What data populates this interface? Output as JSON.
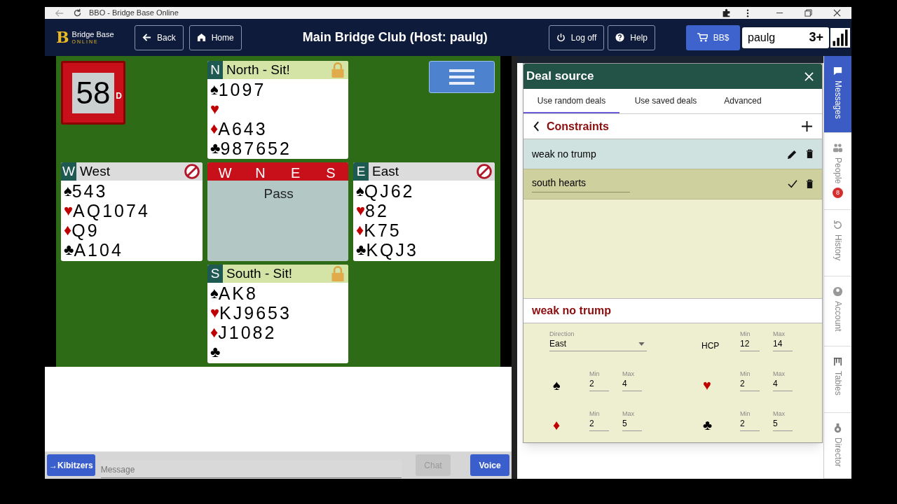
{
  "browser": {
    "title": "BBO - Bridge Base Online"
  },
  "nav": {
    "logo_mark": "B",
    "logo_text": "Bridge Base",
    "logo_subtext": "ONLINE",
    "left_buttons": [
      {
        "label": "Back"
      },
      {
        "label": "Home"
      }
    ],
    "title": "Main Bridge Club (Host: paulg)",
    "right_buttons": [
      {
        "label": "Log off"
      },
      {
        "label": "Help"
      }
    ],
    "bucks_button": "BB$",
    "username": "paulg",
    "rank": "3+"
  },
  "table": {
    "board": "58",
    "dealer": "D",
    "hands": [
      {
        "letter": "N",
        "name": "North - Sit!",
        "kind": "open",
        "suits": [
          {
            "kind": "spade",
            "symbol": "♠",
            "cards": "1097"
          },
          {
            "kind": "heart",
            "symbol": "♥"
          },
          {
            "kind": "diamond",
            "symbol": "♦",
            "cards": "A643"
          },
          {
            "kind": "club",
            "symbol": "♣",
            "cards": "987652"
          }
        ]
      },
      {
        "letter": "W",
        "name": "West",
        "kind": "occupied",
        "suits": [
          {
            "kind": "spade",
            "symbol": "♠",
            "cards": "543"
          },
          {
            "kind": "heart",
            "symbol": "♥",
            "cards": "AQ1074"
          },
          {
            "kind": "diamond",
            "symbol": "♦",
            "cards": "Q9"
          },
          {
            "kind": "club",
            "symbol": "♣",
            "cards": "A104"
          }
        ]
      },
      {
        "letter": "E",
        "name": "East",
        "kind": "occupied",
        "suits": [
          {
            "kind": "spade",
            "symbol": "♠",
            "cards": "QJ62"
          },
          {
            "kind": "heart",
            "symbol": "♥",
            "cards": "82"
          },
          {
            "kind": "diamond",
            "symbol": "♦",
            "cards": "K75"
          },
          {
            "kind": "club",
            "symbol": "♣",
            "cards": "KQJ3"
          }
        ]
      },
      {
        "letter": "S",
        "name": "South - Sit!",
        "kind": "open",
        "suits": [
          {
            "kind": "spade",
            "symbol": "♠",
            "cards": "AK8"
          },
          {
            "kind": "heart",
            "symbol": "♥",
            "cards": "KJ9653"
          },
          {
            "kind": "diamond",
            "symbol": "♦",
            "cards": "J1082"
          },
          {
            "kind": "club",
            "symbol": "♣"
          }
        ]
      }
    ],
    "auction": {
      "seats": [
        "W",
        "N",
        "E",
        "S"
      ],
      "calls": [
        {
          "kind": "blank"
        },
        {
          "kind": "blank"
        },
        {
          "kind": "call",
          "text": "Pass"
        }
      ]
    }
  },
  "chat": {
    "kibitzers_button": "→Kibitzers",
    "message_placeholder": "Message",
    "chat_button": {
      "label": "Chat",
      "disabled": true
    },
    "voice_button": "Voice"
  },
  "deal_source": {
    "title": "Deal source",
    "tabs": [
      {
        "label": "Use random deals",
        "selected": true
      },
      {
        "label": "Use saved deals",
        "selected": false
      },
      {
        "label": "Advanced",
        "selected": false
      }
    ],
    "constraints_title": "Constraints",
    "constraints": [
      {
        "name": "weak no trump",
        "selected": true,
        "editing": false
      },
      {
        "name": "south hearts",
        "selected": false,
        "editing": true
      }
    ],
    "detail": {
      "title": "weak no trump",
      "direction": {
        "label": "Direction",
        "value": "East"
      },
      "hcp": {
        "label": "HCP",
        "min_label": "Min",
        "min": "12",
        "max_label": "Max",
        "max": "14"
      },
      "suits": [
        {
          "kind": "spade",
          "symbol": "♠",
          "min_label": "Min",
          "min": "2",
          "max_label": "Max",
          "max": "4"
        },
        {
          "kind": "heart",
          "symbol": "♥",
          "min_label": "Min",
          "min": "2",
          "max_label": "Max",
          "max": "4"
        },
        {
          "kind": "diamond",
          "symbol": "♦",
          "min_label": "Min",
          "min": "2",
          "max_label": "Max",
          "max": "5"
        },
        {
          "kind": "club",
          "symbol": "♣",
          "min_label": "Min",
          "min": "2",
          "max_label": "Max",
          "max": "5"
        }
      ]
    }
  },
  "sidebar": [
    {
      "label": "Messages",
      "selected": true
    },
    {
      "label": "People",
      "selected": false,
      "badge": "8"
    },
    {
      "label": "History",
      "selected": false
    },
    {
      "label": "Account",
      "selected": false
    },
    {
      "label": "Tables",
      "selected": false
    },
    {
      "label": "Director",
      "selected": false
    }
  ]
}
